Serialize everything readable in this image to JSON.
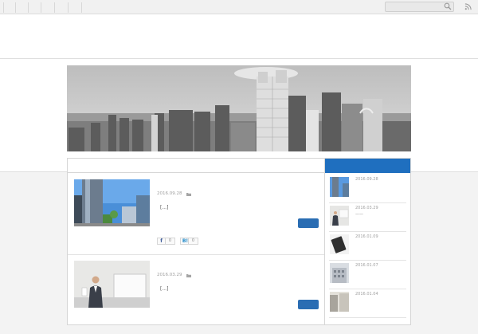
{
  "topbar": {
    "search_placeholder": "",
    "nav_separators": 6,
    "icons": [
      "search-icon",
      "rss-icon"
    ]
  },
  "hero": {
    "alt_description_icon": "city-skyline-image"
  },
  "posts": [
    {
      "date": "2016.09.28",
      "excerpt": "[...]",
      "share": [
        {
          "label": "f",
          "count": "0"
        },
        {
          "label": "B!",
          "count": "0"
        }
      ]
    },
    {
      "date": "2016.03.29",
      "excerpt": "[...]"
    }
  ],
  "sidebar": {
    "items": [
      {
        "date": "2016.09.28",
        "title": ""
      },
      {
        "date": "2016.03.29",
        "title": "——"
      },
      {
        "date": "2016.01.09",
        "title": ""
      },
      {
        "date": "2016.01.07",
        "title": ""
      },
      {
        "date": "2016.01.04",
        "title": ""
      }
    ]
  },
  "colors": {
    "accent": "#1f6fbf",
    "button": "#2a6db3"
  }
}
